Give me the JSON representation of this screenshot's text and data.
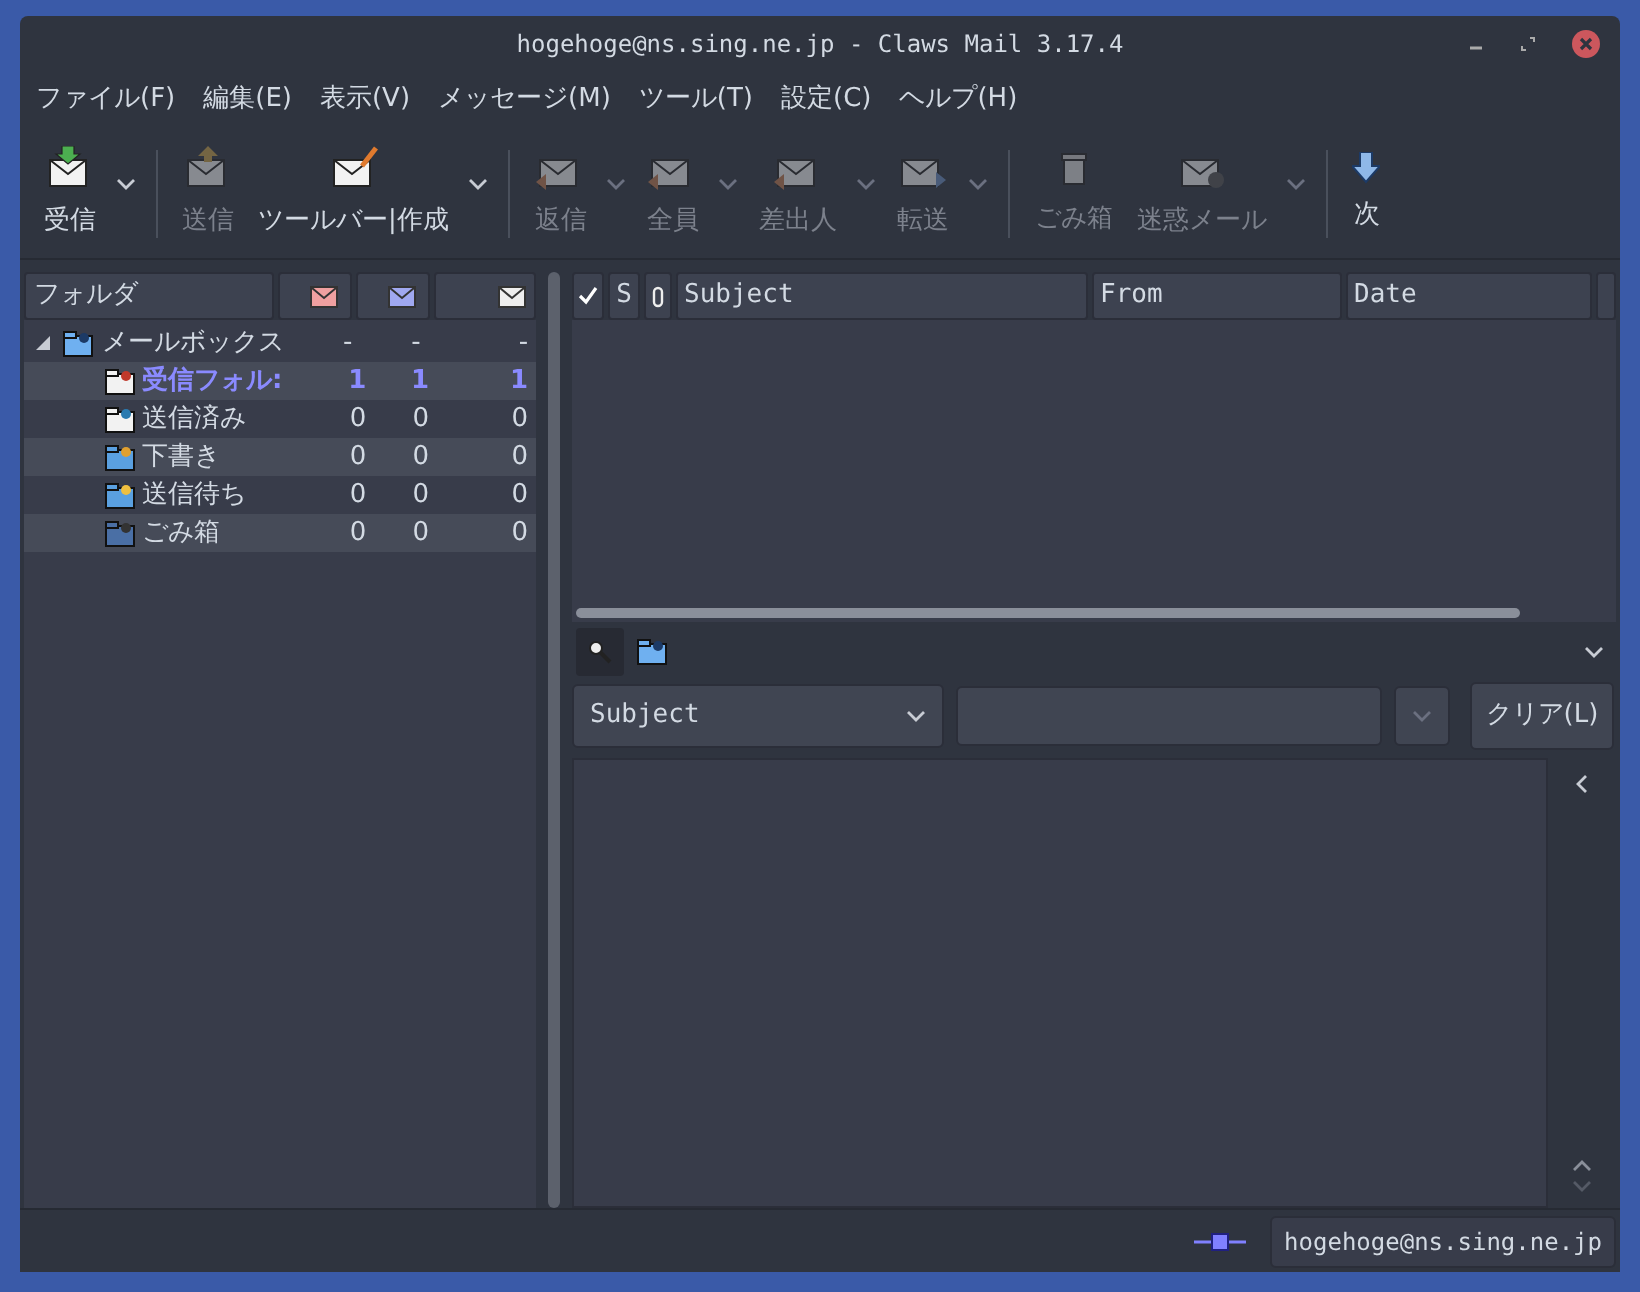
{
  "window": {
    "title": "hogehoge@ns.sing.ne.jp - Claws Mail 3.17.4"
  },
  "menu": [
    "ファイル(F)",
    "編集(E)",
    "表示(V)",
    "メッセージ(M)",
    "ツール(T)",
    "設定(C)",
    "ヘルプ(H)"
  ],
  "toolbar": [
    {
      "kind": "button",
      "label": "受信",
      "disabled": false,
      "dropdown": true
    },
    {
      "kind": "separator"
    },
    {
      "kind": "button",
      "label": "送信",
      "disabled": true,
      "dropdown": false
    },
    {
      "kind": "button",
      "label": "ツールバー|作成",
      "disabled": false,
      "dropdown": true
    },
    {
      "kind": "separator"
    },
    {
      "kind": "button",
      "label": "返信",
      "disabled": true,
      "dropdown": true
    },
    {
      "kind": "button",
      "label": "全員",
      "disabled": true,
      "dropdown": true
    },
    {
      "kind": "button",
      "label": "差出人",
      "disabled": true,
      "dropdown": true
    },
    {
      "kind": "button",
      "label": "転送",
      "disabled": true,
      "dropdown": true
    },
    {
      "kind": "separator"
    },
    {
      "kind": "button",
      "label": "ごみ箱",
      "disabled": true,
      "dropdown": false
    },
    {
      "kind": "button",
      "label": "迷惑メール",
      "disabled": true,
      "dropdown": true
    },
    {
      "kind": "separator"
    },
    {
      "kind": "button",
      "label": "次",
      "disabled": false,
      "dropdown": false
    }
  ],
  "folder_pane": {
    "header": "フォルダ",
    "root": {
      "name": "メールボックス",
      "expanded": true,
      "counts": [
        "-",
        "-",
        "-"
      ],
      "children": [
        {
          "name": "受信フォル:",
          "unread": true,
          "counts": [
            "1",
            "1",
            "1"
          ]
        },
        {
          "name": "送信済み",
          "unread": false,
          "counts": [
            "0",
            "0",
            "0"
          ]
        },
        {
          "name": "下書き",
          "unread": false,
          "counts": [
            "0",
            "0",
            "0"
          ]
        },
        {
          "name": "送信待ち",
          "unread": false,
          "counts": [
            "0",
            "0",
            "0"
          ]
        },
        {
          "name": "ごみ箱",
          "unread": false,
          "counts": [
            "0",
            "0",
            "0"
          ]
        }
      ]
    }
  },
  "message_list": {
    "columns": [
      "S",
      "Subject",
      "From",
      "Date"
    ]
  },
  "search": {
    "field": "Subject",
    "clear_button": "クリア(L)"
  },
  "status_bar": {
    "account": "hogehoge@ns.sing.ne.jp"
  }
}
